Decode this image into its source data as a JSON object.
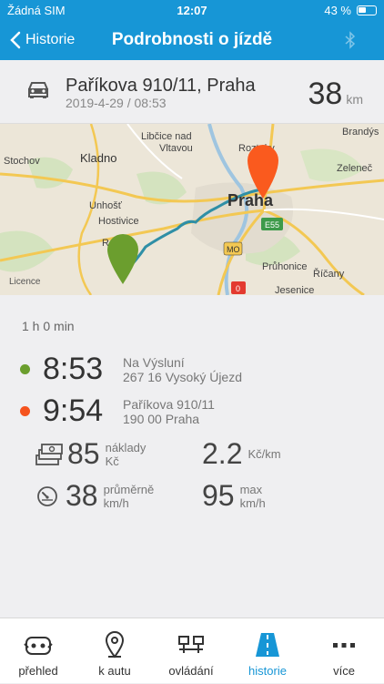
{
  "status_bar": {
    "carrier": "Žádná SIM",
    "time": "12:07",
    "battery": "43 %"
  },
  "nav": {
    "back_label": "Historie",
    "title": "Podrobnosti o jízdě"
  },
  "trip": {
    "address": "Paříkova 910/11, Praha",
    "datetime": "2019-4-29 / 08:53",
    "distance": "38",
    "distance_unit": "km"
  },
  "map": {
    "labels": {
      "libcice": "Libčice nad",
      "vltavou": "Vltavou",
      "roztoky": "Roztoky",
      "brandys": "Brandýs",
      "stochov": "Stochov",
      "kladno": "Kladno",
      "praha": "Praha",
      "zeleneč": "Zeleneč",
      "unhost": "Unhošť",
      "hostivice": "Hostivice",
      "pruhonice": "Průhonice",
      "ricany": "Říčany",
      "jesenice": "Jesenice",
      "licence": "Licence",
      "r": "R"
    },
    "road_badges": {
      "e55": "E55",
      "mo": "MO",
      "zero": "0"
    },
    "route_color": "#2f8fa6",
    "start_pin_color": "#6b9e2e",
    "end_pin_color": "#fa5a1e"
  },
  "details": {
    "duration": "1 h 0 min",
    "start": {
      "time": "8:53",
      "line1": "Na Výsluní",
      "line2": "267 16 Vysoký Újezd",
      "color": "#6b9e2e"
    },
    "end": {
      "time": "9:54",
      "line1": "Paříkova 910/11",
      "line2": "190 00 Praha",
      "color": "#f5531e"
    },
    "cost": {
      "value": "85",
      "label": "náklady",
      "unit": "Kč"
    },
    "cost_per_km": {
      "value": "2.2",
      "unit": "Kč/km"
    },
    "avg_speed": {
      "value": "38",
      "label": "průměrně",
      "unit": "km/h"
    },
    "max_speed": {
      "value": "95",
      "label": "max",
      "unit": "km/h"
    }
  },
  "tabs": [
    {
      "label": "přehled",
      "icon": "car-overview-icon"
    },
    {
      "label": "k autu",
      "icon": "location-pin-icon"
    },
    {
      "label": "ovládání",
      "icon": "controls-icon"
    },
    {
      "label": "historie",
      "icon": "road-history-icon"
    },
    {
      "label": "více",
      "icon": "more-dots-icon"
    }
  ],
  "accent_color": "#1796d6"
}
